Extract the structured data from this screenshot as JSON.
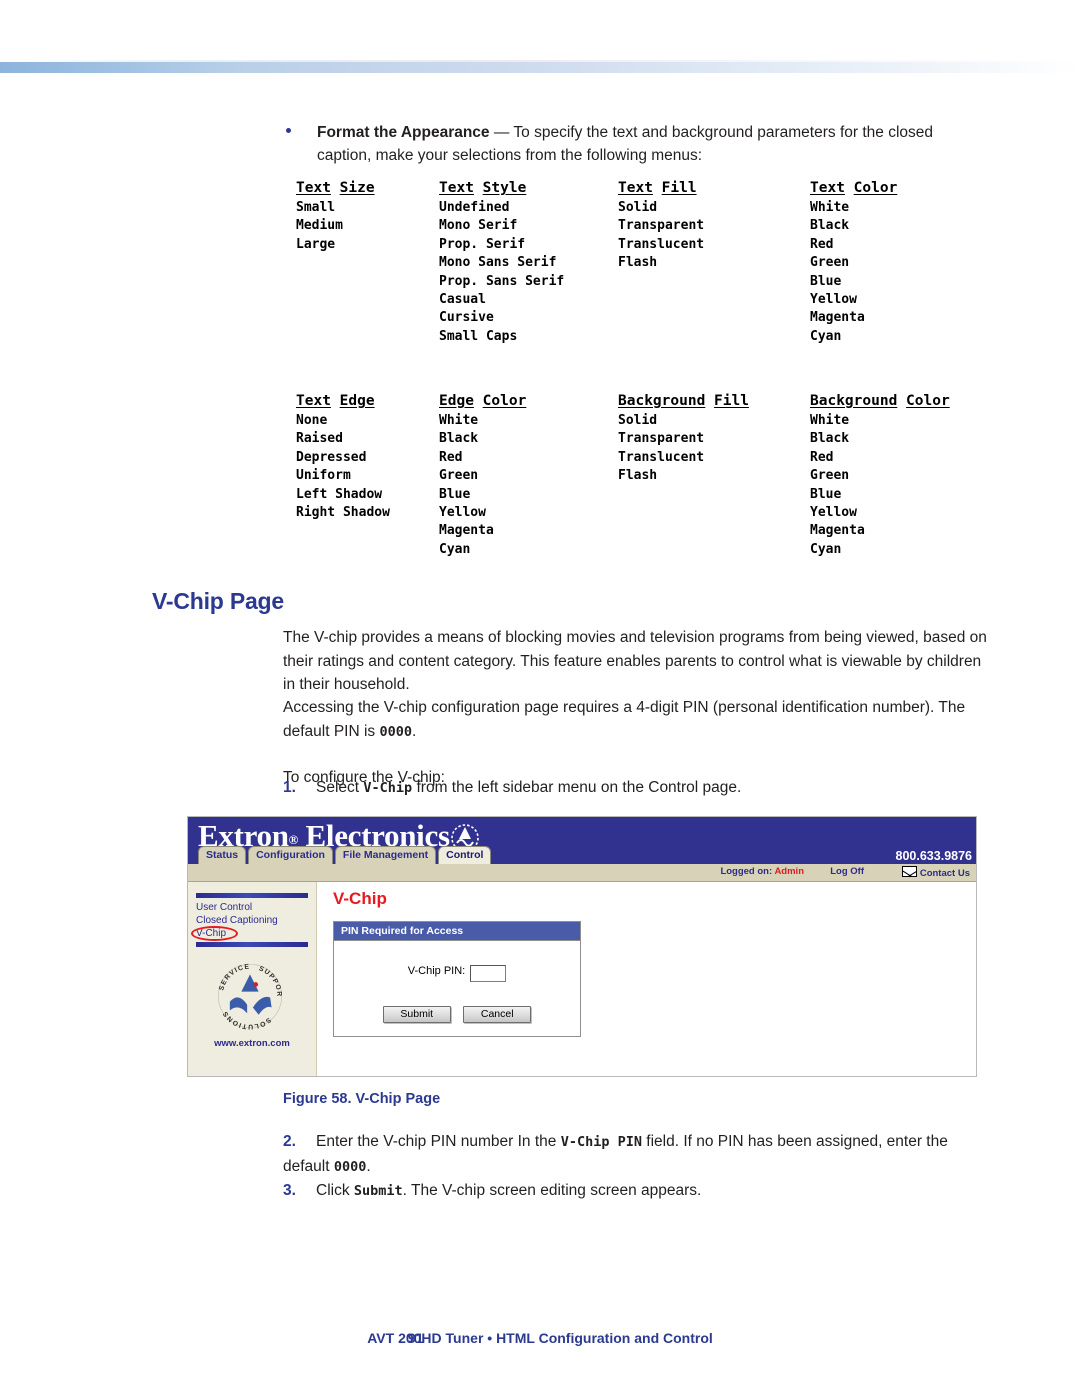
{
  "colors": {
    "heading_blue": "#2b3990",
    "accent_red": "#e8191f",
    "web_header_blue": "#31318f",
    "tab_tan": "#d8d3b8"
  },
  "intro_bullet": {
    "lead": "Format the Appearance",
    "rest": " — To specify the text and background parameters for the closed caption, make your selections from the following menus:"
  },
  "menus": {
    "row1": [
      {
        "title_part1": "Text",
        "title_part2": "Size",
        "items": [
          "Small",
          "Medium",
          "Large"
        ]
      },
      {
        "title_part1": "Text",
        "title_part2": "Style",
        "items": [
          "Undefined",
          "Mono Serif",
          "Prop. Serif",
          "Mono Sans Serif",
          "Prop. Sans Serif",
          "Casual",
          "Cursive",
          "Small Caps"
        ]
      },
      {
        "title_part1": "Text",
        "title_part2": "Fill",
        "items": [
          "Solid",
          "Transparent",
          "Translucent",
          "Flash"
        ]
      },
      {
        "title_part1": "Text",
        "title_part2": "Color",
        "items": [
          "White",
          "Black",
          "Red",
          "Green",
          "Blue",
          "Yellow",
          "Magenta",
          "Cyan"
        ]
      }
    ],
    "row2": [
      {
        "title_part1": "Text",
        "title_part2": "Edge",
        "items": [
          "None",
          "Raised",
          "Depressed",
          "Uniform",
          "Left Shadow",
          "Right Shadow"
        ]
      },
      {
        "title_part1": "Edge",
        "title_part2": "Color",
        "items": [
          "White",
          "Black",
          "Red",
          "Green",
          "Blue",
          "Yellow",
          "Magenta",
          "Cyan"
        ]
      },
      {
        "title_part1": "Background",
        "title_part2": "Fill",
        "items": [
          "Solid",
          "Transparent",
          "Translucent",
          "Flash"
        ]
      },
      {
        "title_part1": "Background",
        "title_part2": "Color",
        "items": [
          "White",
          "Black",
          "Red",
          "Green",
          "Blue",
          "Yellow",
          "Magenta",
          "Cyan"
        ]
      }
    ]
  },
  "section": {
    "heading": "V-Chip Page",
    "para1": "The V-chip provides a means of blocking movies and television programs from being viewed, based on their ratings and content category. This feature enables parents to control what is viewable by children in their household.",
    "para2_a": "Accessing the V-chip configuration page requires a 4-digit PIN (personal identification number). The default PIN is ",
    "para2_code": "0000",
    "para2_b": ".",
    "para3": "To configure the V-chip:"
  },
  "steps": {
    "one": {
      "num": "1.",
      "a": "Select ",
      "code": "V-Chip",
      "b": " from the left sidebar menu on the Control page."
    },
    "two": {
      "num": "2.",
      "a": "Enter the V-chip PIN number In the ",
      "code": "V-Chip PIN",
      "b": " field. If no PIN has been assigned, enter the default ",
      "code2": "0000",
      "c": "."
    },
    "three": {
      "num": "3.",
      "a": "Click ",
      "code": "Submit",
      "b": ". The V-chip screen editing screen appears."
    }
  },
  "figure": {
    "caption_num": "Figure 58.",
    "caption_text": " V-Chip Page",
    "web": {
      "logo_main": "Extron",
      "logo_reg": "®",
      "logo_second": " Electronics",
      "tabs": [
        {
          "label": "Status",
          "active": false
        },
        {
          "label": "Configuration",
          "active": false
        },
        {
          "label": "File Management",
          "active": false
        },
        {
          "label": "Control",
          "active": true
        }
      ],
      "phone": "800.633.9876",
      "logged_on_label": "Logged on: ",
      "logged_on_user": "Admin",
      "log_off": "Log Off",
      "contact_us": "Contact Us",
      "sidebar": {
        "items": [
          "User Control",
          "Closed Captioning",
          "V-Chip"
        ],
        "url": "www.extron.com",
        "logo_words": [
          "SERVICE",
          "SUPPORT",
          "SOLUTIONS"
        ]
      },
      "page_title": "V-Chip",
      "panel": {
        "header": "PIN Required for Access",
        "pin_label": "V-Chip PIN:",
        "pin_value": "",
        "submit": "Submit",
        "cancel": "Cancel"
      }
    }
  },
  "footer": {
    "text": "AVT 200HD Tuner • HTML Configuration and Control",
    "page": "91"
  }
}
